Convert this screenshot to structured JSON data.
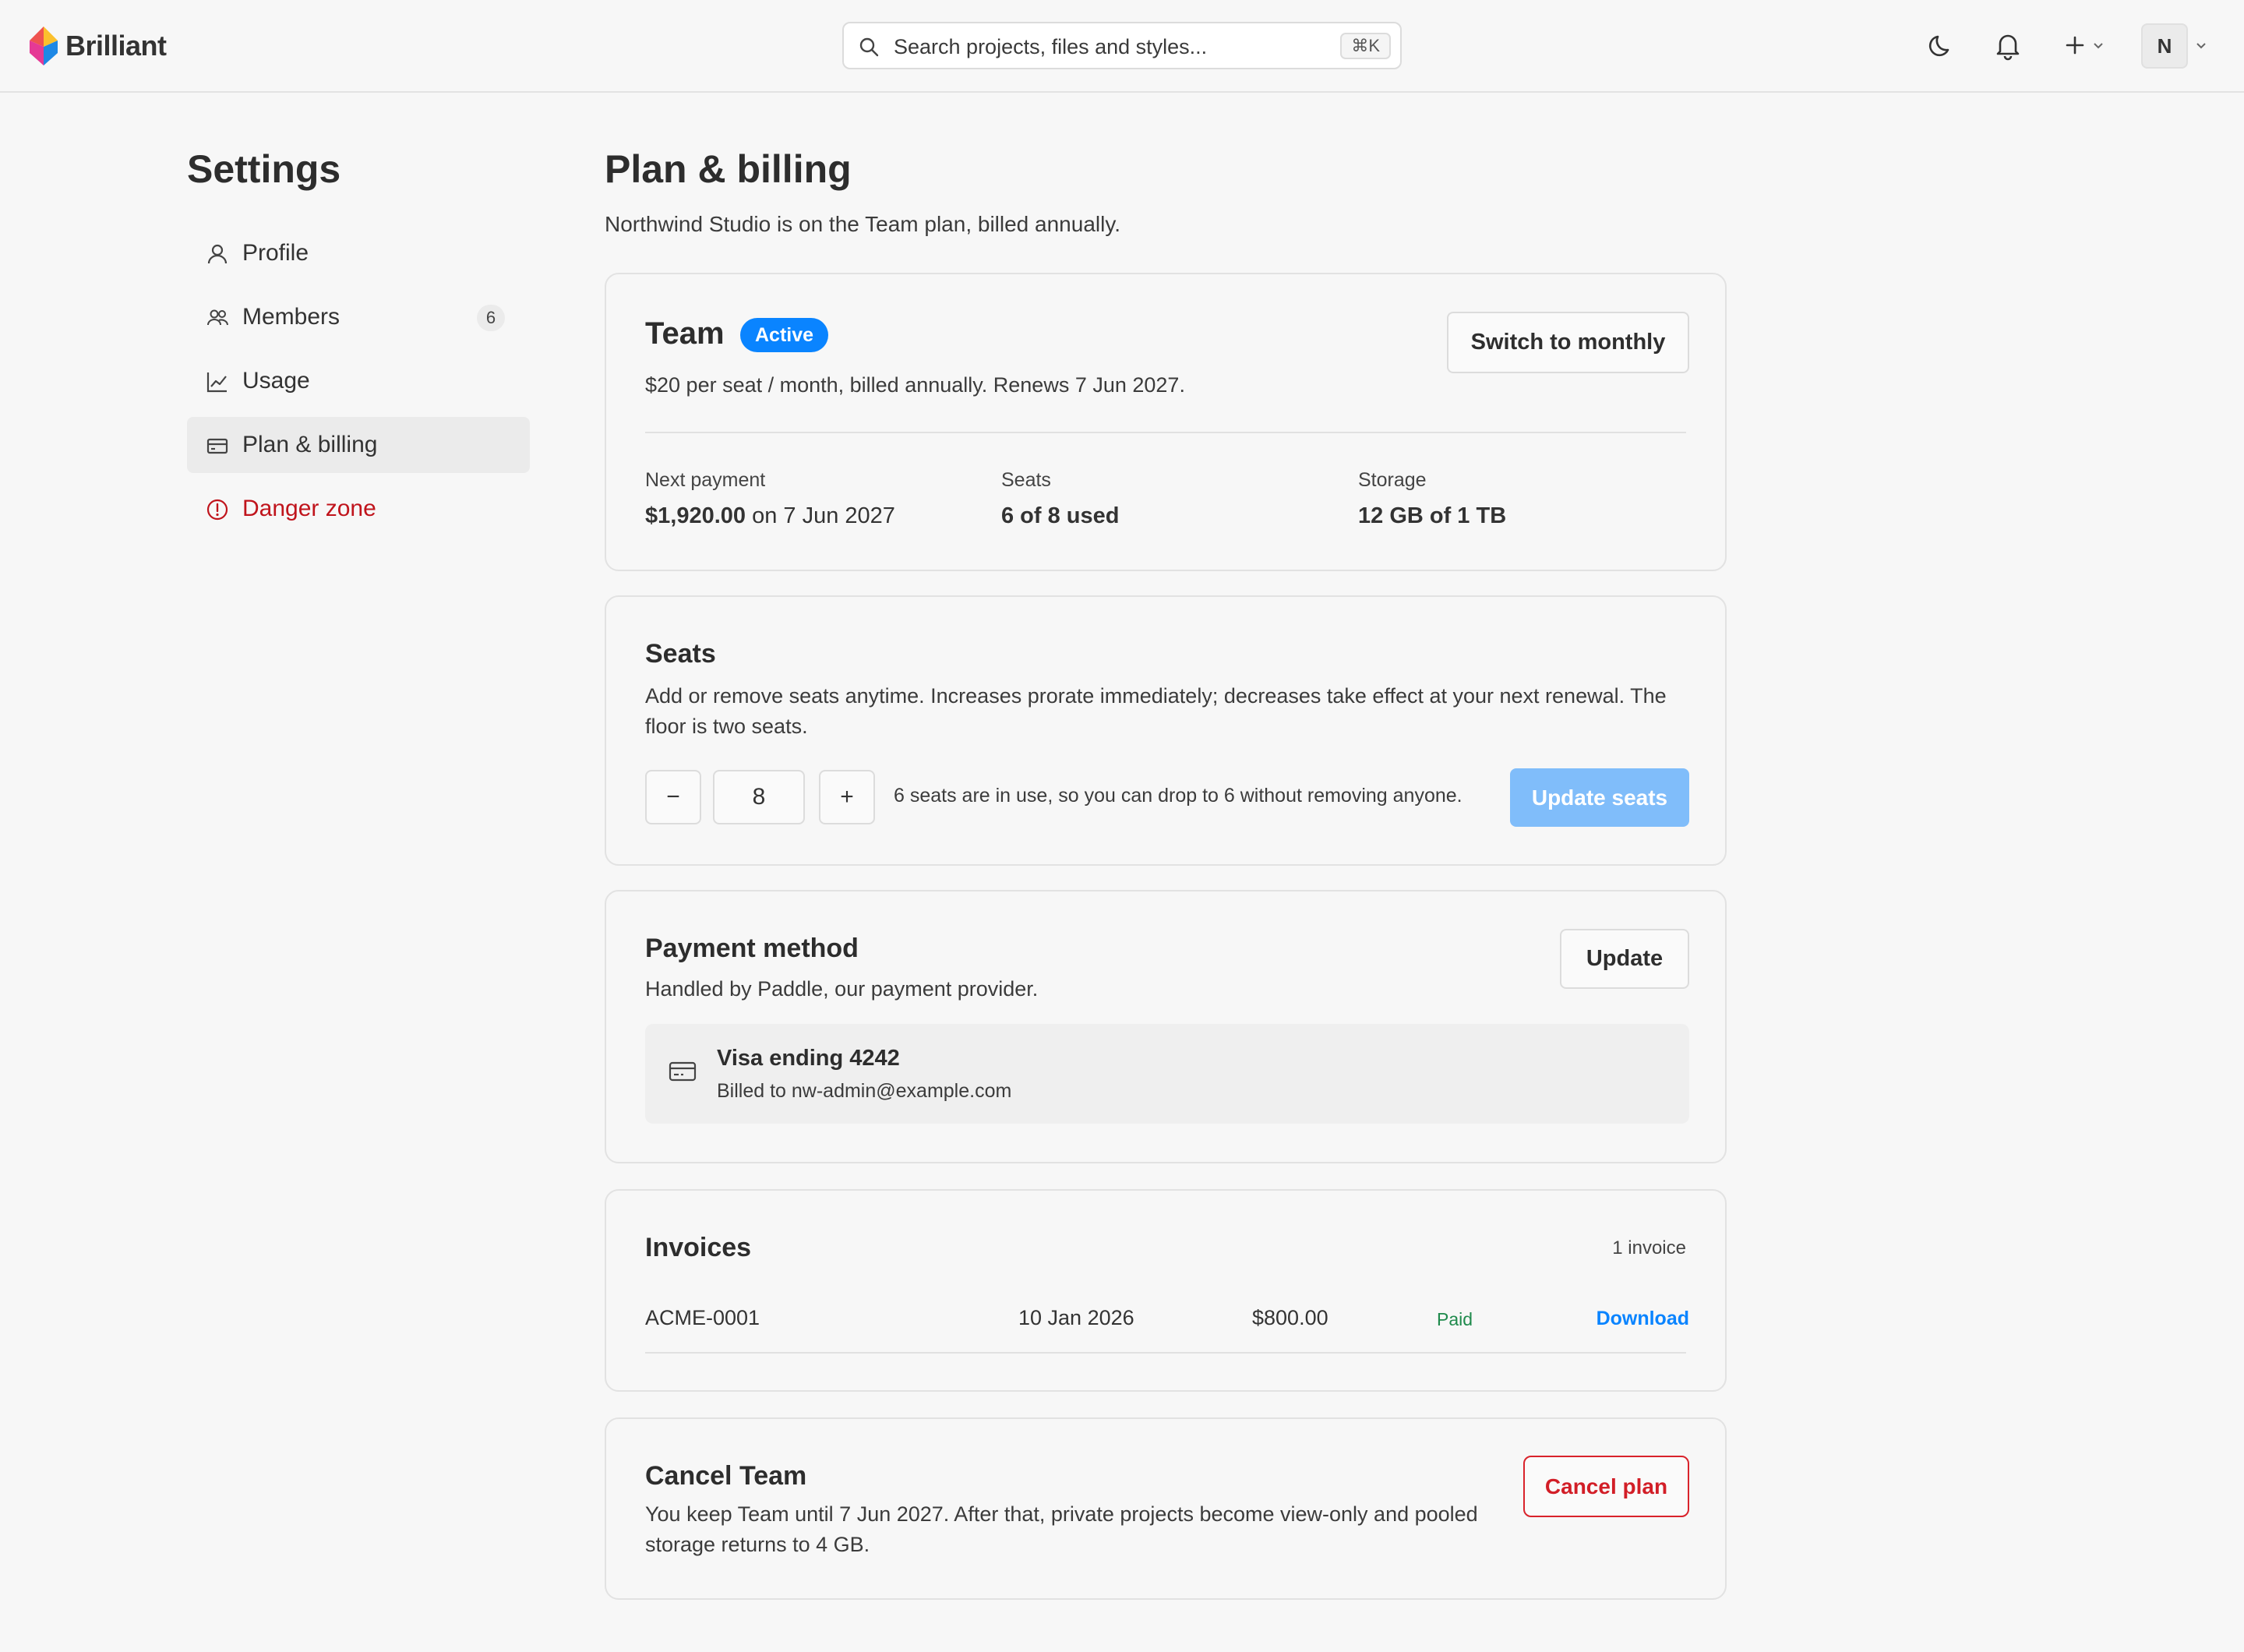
{
  "header": {
    "brand": "Brilliant",
    "search": {
      "placeholder": "Search projects, files and styles...",
      "shortcut": "⌘K"
    },
    "avatar_initial": "N"
  },
  "sidebar": {
    "title": "Settings",
    "items": [
      {
        "label": "Profile",
        "icon": "user-icon"
      },
      {
        "label": "Members",
        "icon": "users-icon",
        "badge": "6"
      },
      {
        "label": "Usage",
        "icon": "chart-icon"
      },
      {
        "label": "Plan & billing",
        "icon": "card-icon",
        "active": true
      },
      {
        "label": "Danger zone",
        "icon": "alert-circle-icon",
        "danger": true
      }
    ]
  },
  "main": {
    "title": "Plan & billing",
    "subtitle": "Northwind Studio is on the Team plan, billed annually.",
    "plan": {
      "name": "Team",
      "status": "Active",
      "description": "$20 per seat / month, billed annually. Renews 7 Jun 2027.",
      "switch_label": "Switch to monthly",
      "next_payment_label": "Next payment",
      "next_payment_amount": "$1,920.00",
      "next_payment_date": "on 7 Jun 2027",
      "seats_label": "Seats",
      "seats_value": "6 of 8 used",
      "storage_label": "Storage",
      "storage_value": "12 GB of 1 TB"
    },
    "seats": {
      "title": "Seats",
      "description": "Add or remove seats anytime. Increases prorate immediately; decreases take effect at your next renewal. The floor is two seats.",
      "decrement": "−",
      "value": "8",
      "increment": "+",
      "hint": "6 seats are in use, so you can drop to 6 without removing anyone.",
      "update_label": "Update seats"
    },
    "payment": {
      "title": "Payment method",
      "description": "Handled by Paddle, our payment provider.",
      "update_label": "Update",
      "card_name": "Visa ending 4242",
      "card_billed": "Billed to nw-admin@example.com"
    },
    "invoices": {
      "title": "Invoices",
      "count": "1 invoice",
      "rows": [
        {
          "id": "ACME-0001",
          "date": "10 Jan 2026",
          "amount": "$800.00",
          "status": "Paid",
          "action": "Download"
        }
      ]
    },
    "cancel": {
      "title": "Cancel Team",
      "description": "You keep Team until 7 Jun 2027. After that, private projects become view-only and pooled storage returns to 4 GB.",
      "button": "Cancel plan"
    }
  },
  "colors": {
    "accent": "#0a84ff",
    "danger": "#d21e27",
    "paid": "#1f8a4c",
    "primary_disabled": "#80bdfa"
  }
}
